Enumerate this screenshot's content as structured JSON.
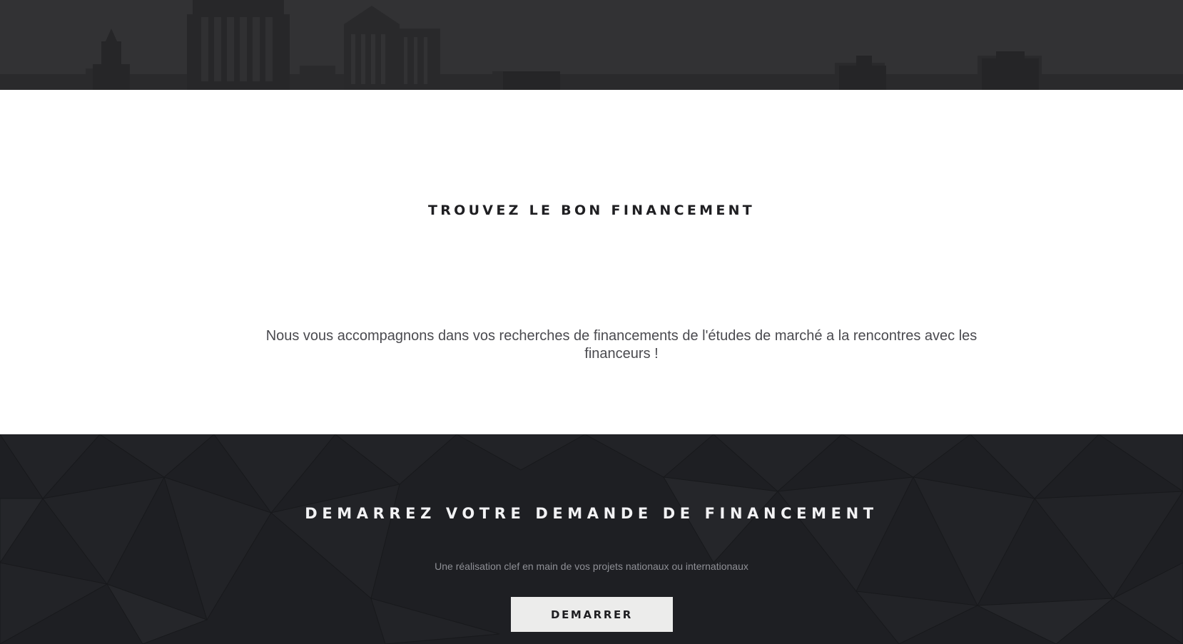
{
  "hero": {
    "image": "city-skyline-background"
  },
  "intro": {
    "title": "TROUVEZ LE BON FINANCEMENT",
    "text": "Nous vous accompagnons dans vos recherches de financements de l'études de marché a la rencontres avec les financeurs !"
  },
  "cta": {
    "title": "DEMARREZ VOTRE DEMANDE DE FINANCEMENT",
    "subtitle": "Une réalisation clef en main de vos projets nationaux ou internationaux",
    "button_label": "DEMARRER",
    "background": "dark-polygon-pattern"
  },
  "colors": {
    "dark_background": "#1e1f23",
    "hero_background": "#313133",
    "button_background": "#ececeb",
    "heading_text": "#1f1f22"
  }
}
